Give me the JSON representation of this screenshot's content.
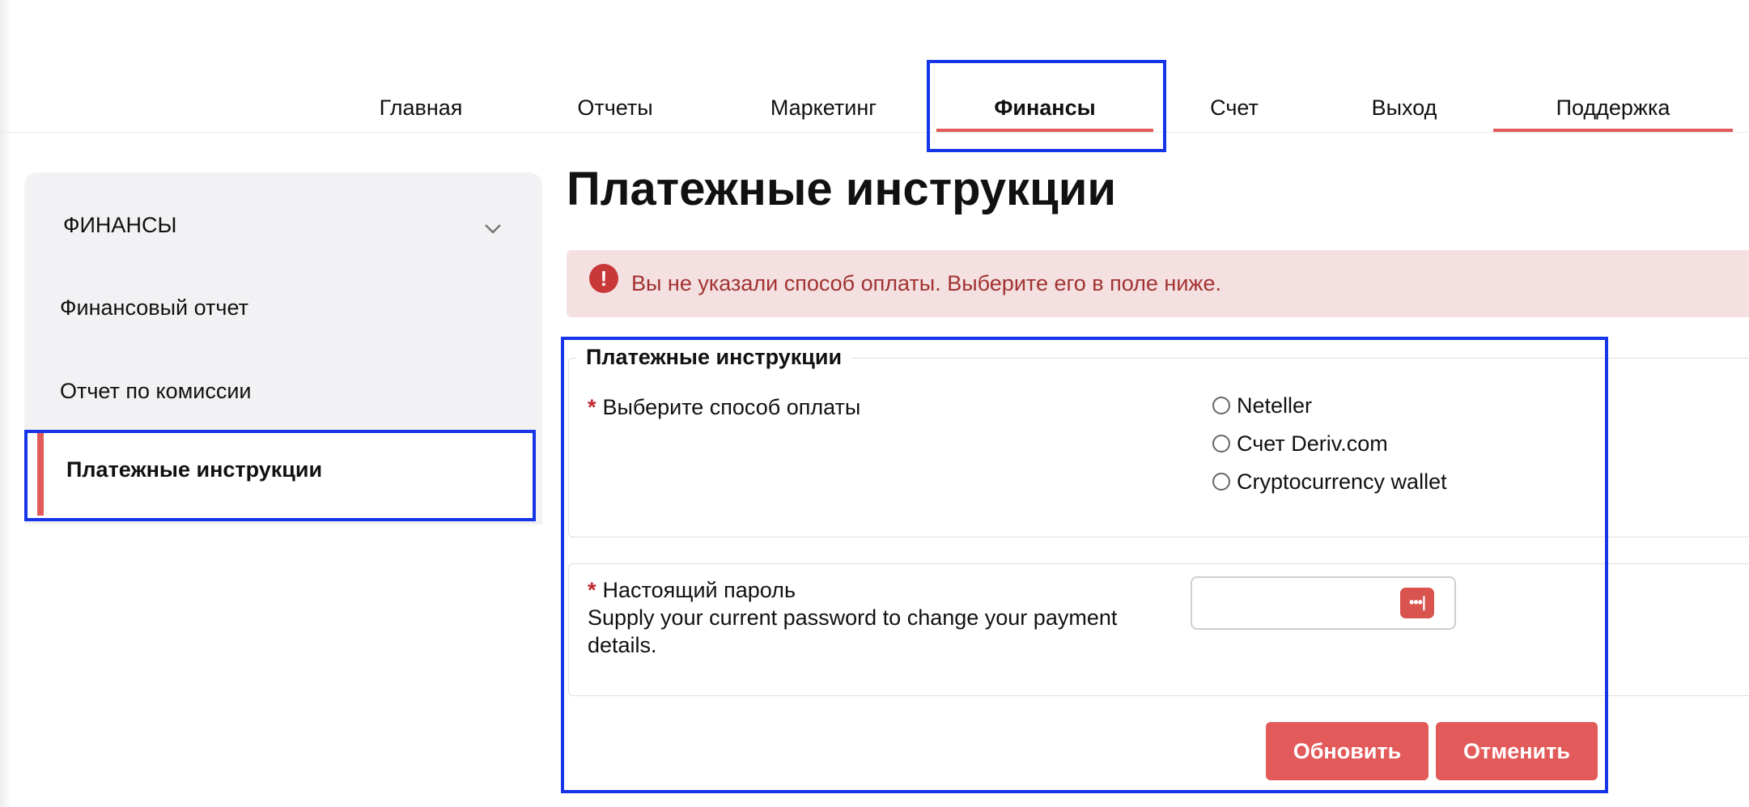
{
  "nav": {
    "items": [
      {
        "label": "Главная",
        "active": false
      },
      {
        "label": "Отчеты",
        "active": false
      },
      {
        "label": "Маркетинг",
        "active": false
      },
      {
        "label": "Финансы",
        "active": true
      },
      {
        "label": "Счет",
        "active": false
      },
      {
        "label": "Выход",
        "active": false
      },
      {
        "label": "Поддержка",
        "active": false
      }
    ]
  },
  "sidebar": {
    "section_title": "ФИНАНСЫ",
    "items": [
      {
        "label": "Финансовый отчет",
        "active": false
      },
      {
        "label": "Отчет по комиссии",
        "active": false
      },
      {
        "label": "Платежные инструкции",
        "active": true
      }
    ]
  },
  "main": {
    "title": "Платежные инструкции",
    "alert": {
      "icon": "exclamation-icon",
      "text": "Вы не указали способ оплаты. Выберите его в поле ниже."
    },
    "form": {
      "legend": "Платежные инструкции",
      "required_mark": "*",
      "payment_method": {
        "label": "Выберите способ оплаты",
        "options": [
          "Neteller",
          "Счет Deriv.com",
          "Cryptocurrency wallet"
        ],
        "selected": null
      },
      "password": {
        "label": "Настоящий пароль",
        "help": "Supply your current password to change your payment details.",
        "value": "",
        "icon": "password-manager-icon"
      },
      "buttons": {
        "update": "Обновить",
        "cancel": "Отменить"
      }
    }
  },
  "colors": {
    "accent": "#e25a5a",
    "alert_bg": "#f4e0e0",
    "alert_text": "#a23232",
    "highlight": "#1634e8",
    "sidebar_bg": "#f2f2f4"
  }
}
